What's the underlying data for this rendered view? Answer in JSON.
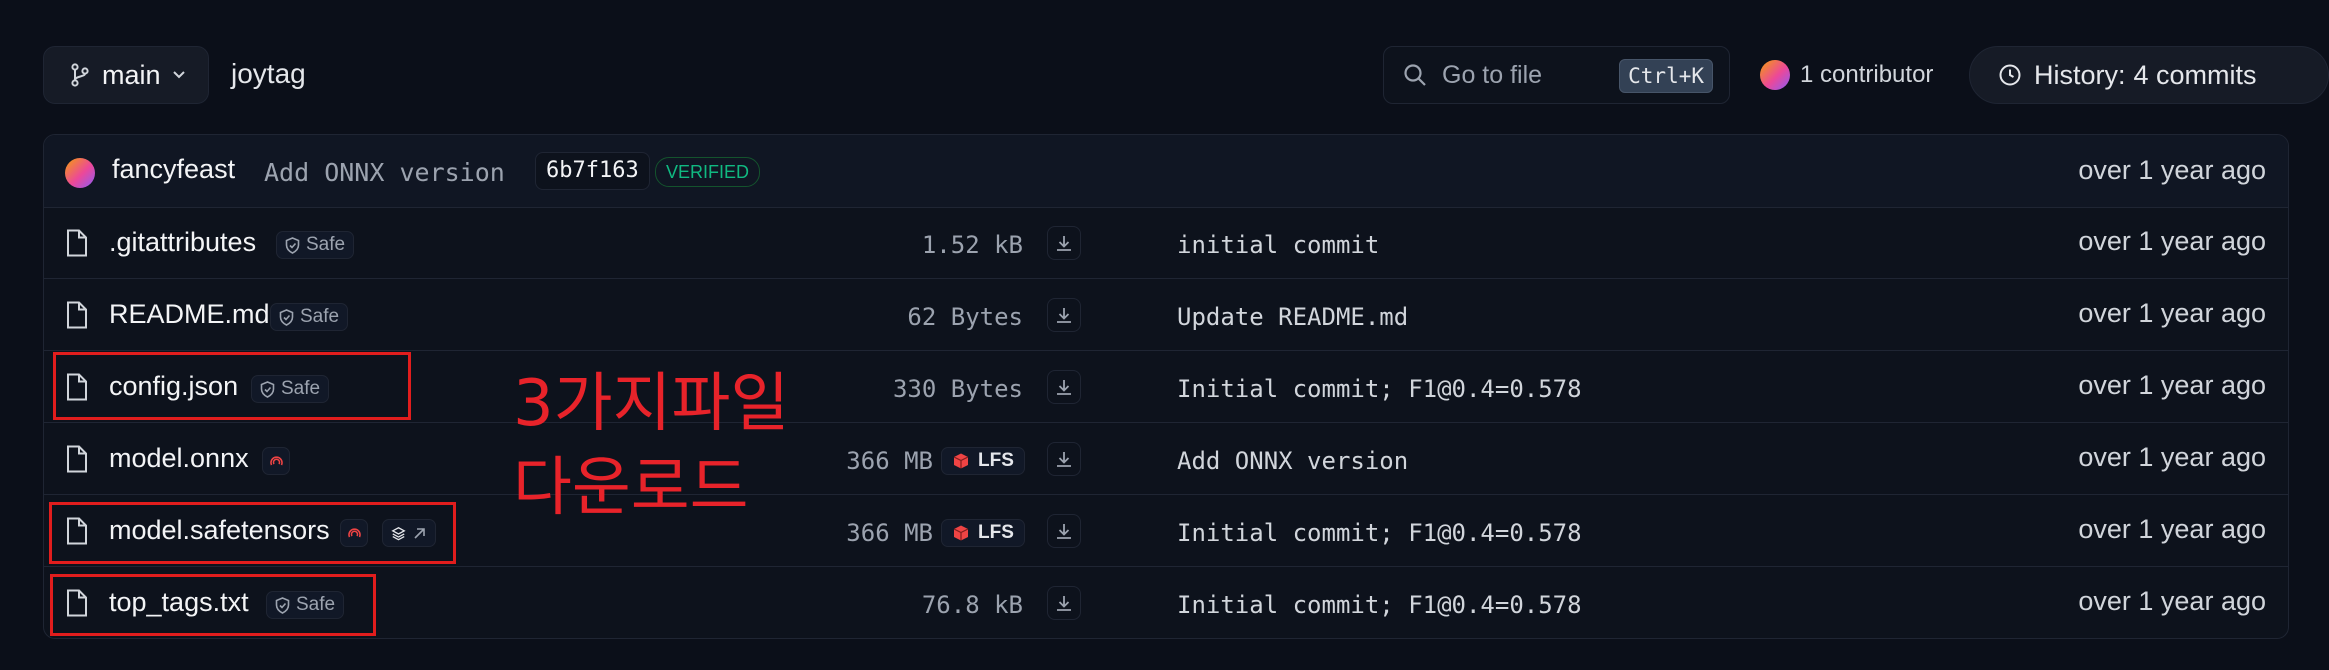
{
  "branch": {
    "name": "main"
  },
  "repo": {
    "name": "joytag"
  },
  "search": {
    "placeholder": "Go to file",
    "shortcut": "Ctrl+K"
  },
  "contributors": {
    "label": "1 contributor"
  },
  "history": {
    "label": "History:",
    "count": "4 commits"
  },
  "last_commit": {
    "author": "fancyfeast",
    "message": "Add ONNX version",
    "sha": "6b7f163",
    "verified": "VERIFIED",
    "time": "over 1 year ago"
  },
  "files": [
    {
      "name": ".gitattributes",
      "badge": "Safe",
      "size": "1.52 kB",
      "message": "initial commit",
      "time": "over 1 year ago"
    },
    {
      "name": "README.md",
      "badge": "Safe",
      "size": "62 Bytes",
      "message": "Update README.md",
      "time": "over 1 year ago"
    },
    {
      "name": "config.json",
      "badge": "Safe",
      "size": "330 Bytes",
      "message": "Initial commit; F1@0.4=0.578",
      "time": "over 1 year ago"
    },
    {
      "name": "model.onnx",
      "size": "366 MB",
      "lfs": "LFS",
      "message": "Add ONNX version",
      "time": "over 1 year ago"
    },
    {
      "name": "model.safetensors",
      "size": "366 MB",
      "lfs": "LFS",
      "message": "Initial commit; F1@0.4=0.578",
      "time": "over 1 year ago"
    },
    {
      "name": "top_tags.txt",
      "badge": "Safe",
      "size": "76.8 kB",
      "message": "Initial commit; F1@0.4=0.578",
      "time": "over 1 year ago"
    }
  ],
  "annotation": {
    "line1": "3가지파일",
    "line2": "다운로드"
  },
  "colors": {
    "background": "#0b0f19",
    "annotation": "#e11d1d",
    "verified": "#10b981",
    "lfs": "#ef4444"
  },
  "icons": [
    "branch-icon",
    "chevron-down-icon",
    "search-icon",
    "clock-icon",
    "file-icon",
    "shield-icon",
    "scan-icon",
    "layers-icon",
    "external-arrow-icon",
    "lfs-icon",
    "download-icon"
  ]
}
